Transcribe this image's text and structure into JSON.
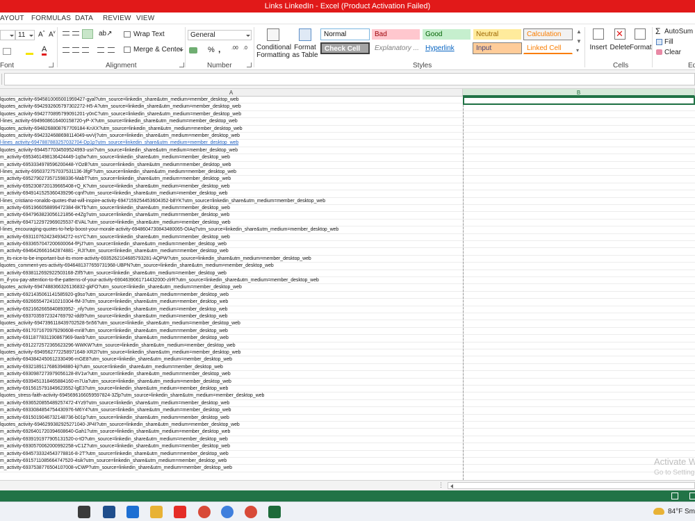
{
  "window": {
    "title": "Links LinkedIn  -  Excel (Product Activation Failed)"
  },
  "ribbon_tabs": [
    "AYOUT",
    "FORMULAS",
    "DATA",
    "REVIEW",
    "VIEW"
  ],
  "font_group": {
    "size": "11",
    "label": "Font"
  },
  "alignment_group": {
    "wrap_text": "Wrap Text",
    "merge_center": "Merge & Center",
    "label": "Alignment"
  },
  "number_group": {
    "format": "General",
    "percent": "%",
    "comma": ",",
    "label": "Number"
  },
  "styles_group": {
    "conditional_formatting": "Conditional Formatting",
    "format_as_table": "Format as Table",
    "label": "Styles",
    "cells": [
      {
        "text": "Normal",
        "bg": "#ffffff",
        "fg": "#111111"
      },
      {
        "text": "Bad",
        "bg": "#ffc7ce",
        "fg": "#9c0006"
      },
      {
        "text": "Good",
        "bg": "#c6efce",
        "fg": "#006100"
      },
      {
        "text": "Neutral",
        "bg": "#ffeb9c",
        "fg": "#9c6500"
      },
      {
        "text": "Calculation",
        "bg": "#f2f2f2",
        "fg": "#fa7d00"
      },
      {
        "text": "Check Cell",
        "bg": "#a5a5a5",
        "fg": "#ffffff"
      },
      {
        "text": "Explanatory ...",
        "bg": "#ffffff",
        "fg": "#7f7f7f"
      },
      {
        "text": "Hyperlink",
        "bg": "#ffffff",
        "fg": "#0563c1"
      },
      {
        "text": "Input",
        "bg": "#ffcc99",
        "fg": "#3f3f76"
      },
      {
        "text": "Linked Cell",
        "bg": "#ffffff",
        "fg": "#fa7d00"
      }
    ]
  },
  "cells_group": {
    "insert": "Insert",
    "delete": "Delete",
    "format": "Format",
    "label": "Cells"
  },
  "editing_group": {
    "autosum": "AutoSum",
    "fill": "Fill",
    "clear": "Clear",
    "label": "Ed"
  },
  "columns": [
    "A",
    "B"
  ],
  "rows": [
    "lquotes_activity-6945810065001959427-gyal?utm_source=linkedin_share&utm_medium=member_desktop_web",
    "lquotes_activity-6942932605797302272-H5-A?utm_source=linkedin_share&utm_medium=member_desktop_web",
    "lquotes_activity-6942770895799091201-y0nC?utm_source=linkedin_share&utm_medium=member_desktop_web",
    "l-lines_activity-6949608616400158720-yP-X?utm_source=linkedin_share&utm_medium=member_desktop_web",
    "lquotes_activity-6948268808767709184-KnXX?utm_source=linkedin_share&utm_medium=member_desktop_web",
    "lquotes_activity-6942324688698114049-wvVj?utm_source=linkedin_share&utm_medium=member_desktop_web",
    "l-lines_activity-6947887883257032704-Dp1p?utm_source=linkedin_share&utm_medium=member_desktop_web",
    "lquotes_activity-6944577034509524993-usri?utm_source=linkedin_share&utm_medium=member_desktop_web",
    "m_activity-6953461498136424449-1q0w?utm_source=linkedin_share&utm_medium=member_desktop_web",
    "m_activity-6953334978596200448-YOzB?utm_source=linkedin_share&utm_medium=member_desktop_web",
    "l-lines_activity-6950372757037531136-3fgF?utm_source=linkedin_share&utm_medium=member_desktop_web",
    "m_activity-6952790273571598336-MabT?utm_source=linkedin_share&utm_medium=member_desktop_web",
    "m_activity-6952308720139665408-rQ_K?utm_source=linkedin_share&utm_medium=member_desktop_web",
    "m_activity-6949141525360439296-cqnf?utm_source=linkedin_share&utm_medium=member_desktop_web",
    "l-lines_cristiano-ronaldo-quotes-that-will-inspire-activity-6947159254453604352-b8YK?utm_source=linkedin_share&utm_medium=member_desktop_web",
    "m_activity-6951966058899472384-8KTb?utm_source=linkedin_share&utm_medium=member_desktop_web",
    "m_activity-6947963823056121856-e4Zg?utm_source=linkedin_share&utm_medium=member_desktop_web",
    "m_activity-6947122972969025537-EVAL?utm_source=linkedin_share&utm_medium=member_desktop_web",
    "l-lines_encouraging-quotes-to-help-boost-your-morale-activity-6948604730843480065-OIAq?utm_source=linkedin_share&utm_medium=member_desktop_web",
    "m_activity-6931107624234934272-nsYC?utm_source=linkedin_share&utm_medium=member_desktop_web",
    "m_activity-6933657047200600064-fPjJ?utm_source=linkedin_share&utm_medium=member_desktop_web",
    "m_activity-6946426661642874881-_RJI?utm_source=linkedin_share&utm_medium=member_desktop_web",
    "m_its-nice-to-be-important-but-its-more-activity-6935262104685793281-AQPW?utm_source=linkedin_share&utm_medium=member_desktop_web",
    "lquotes_comment-yes-activity-6946481377659731968-UBPN?utm_source=linkedin_share&utm_medium=member_desktop_web",
    "m_activity-6938112692922503168-ZIf5?utm_source=linkedin_share&utm_medium=member_desktop_web",
    "m_if-you-pay-attention-to-the-patterns-of-your-activity-6904639061714432000-zlrR?utm_source=linkedin_share&utm_medium=member_desktop_web",
    "lquotes_activity-6947488366326136832-gkFO?utm_source=linkedin_share&utm_medium=member_desktop_web",
    "m_activity-6921435061141585920-g9so?utm_source=linkedin_share&utm_medium=member_desktop_web",
    "m_activity-6926655472410210304-fM-3?utm_source=linkedin_share&utm_medium=member_desktop_web",
    "m_activity-6921662665840893952-_nfy?utm_source=linkedin_share&utm_medium=member_desktop_web",
    "m_activity-6937035972324769792-idd9?utm_source=linkedin_share&utm_medium=member_desktop_web",
    "lquotes_activity-6947396118439702528-5n56?utm_source=linkedin_share&utm_medium=member_desktop_web",
    "m_activity-6917071670979290608-mri8?utm_source=linkedin_share&utm_medium=member_desktop_web",
    "m_activity-6911877831190867969-9anb?utm_source=linkedin_share&utm_medium=member_desktop_web",
    "m_activity-6912272572365623296-WWKW?utm_source=linkedin_share&utm_medium=member_desktop_web",
    "lquotes_activity-6949562772258971648-XR2I?utm_source=linkedin_share&utm_medium=member_desktop_web",
    "m_activity-6943842450612330496-mGE8?utm_source=linkedin_share&utm_medium=member_desktop_web",
    "m_activity-6932189117686394880-kjI?utm_source=linkedin_share&utm_medium=member_desktop_web",
    "m_activity-6930987273979056128-8V1w?utm_source=linkedin_share&utm_medium=member_desktop_web",
    "m_activity-6939451318465884160-m7Ua?utm_source=linkedin_share&utm_medium=member_desktop_web",
    "m_activity-6915615791849623552-lgE3?utm_source=linkedin_share&utm_medium=member_desktop_web",
    "lquotes_stress-faith-activity-6945696166059597824-3Zlp?utm_source=linkedin_share&utm_medium=member_desktop_web",
    "m_activity-6936520855489257472-4Yz9?utm_source=linkedin_share&utm_medium=member_desktop_web",
    "m_activity-6933084854754430976-M6Y4?utm_source=linkedin_share&utm_medium=member_desktop_web",
    "m_activity-6915019046732148736-b01p?utm_source=linkedin_share&utm_medium=member_desktop_web",
    "lquotes_activity-6946299382925271040-JP4I?utm_source=linkedin_share&utm_medium=member_desktop_web",
    "m_activity-6926401720394608640-Gah1?utm_source=linkedin_share&utm_medium=member_desktop_web",
    "m_activity-6939191977905131520-o-tO?utm_source=linkedin_share&utm_medium=member_desktop_web",
    "m_activity-6930570062000992258-vC1Z?utm_source=linkedin_share&utm_medium=member_desktop_web",
    "m_activity-6945733324543778816-8-2T?utm_source=linkedin_share&utm_medium=member_desktop_web",
    "m_activity-6915711085664747520-4sik?utm_source=linkedin_share&utm_medium=member_desktop_web",
    "m_activity-6937538776504107008-vCWP?utm_source=linkedin_share&utm_medium=member_desktop_web"
  ],
  "link_row_index": 6,
  "watermark": {
    "line1": "Activate W",
    "line2": "Go to Setting"
  },
  "taskbar": {
    "weather": "84°F  Sm",
    "apps": [
      {
        "name": "task-view",
        "color": "#3b3b3b"
      },
      {
        "name": "store",
        "color": "#1f4e8c"
      },
      {
        "name": "mail",
        "color": "#1d6fd3"
      },
      {
        "name": "file-explorer",
        "color": "#e8b235"
      },
      {
        "name": "youtube",
        "color": "#e52d27"
      },
      {
        "name": "chrome",
        "color": "#d84a38"
      },
      {
        "name": "chrome-profile",
        "color": "#3f7fdd"
      },
      {
        "name": "chrome-alt",
        "color": "#d84a38"
      },
      {
        "name": "excel",
        "color": "#1d6b3a"
      }
    ]
  }
}
